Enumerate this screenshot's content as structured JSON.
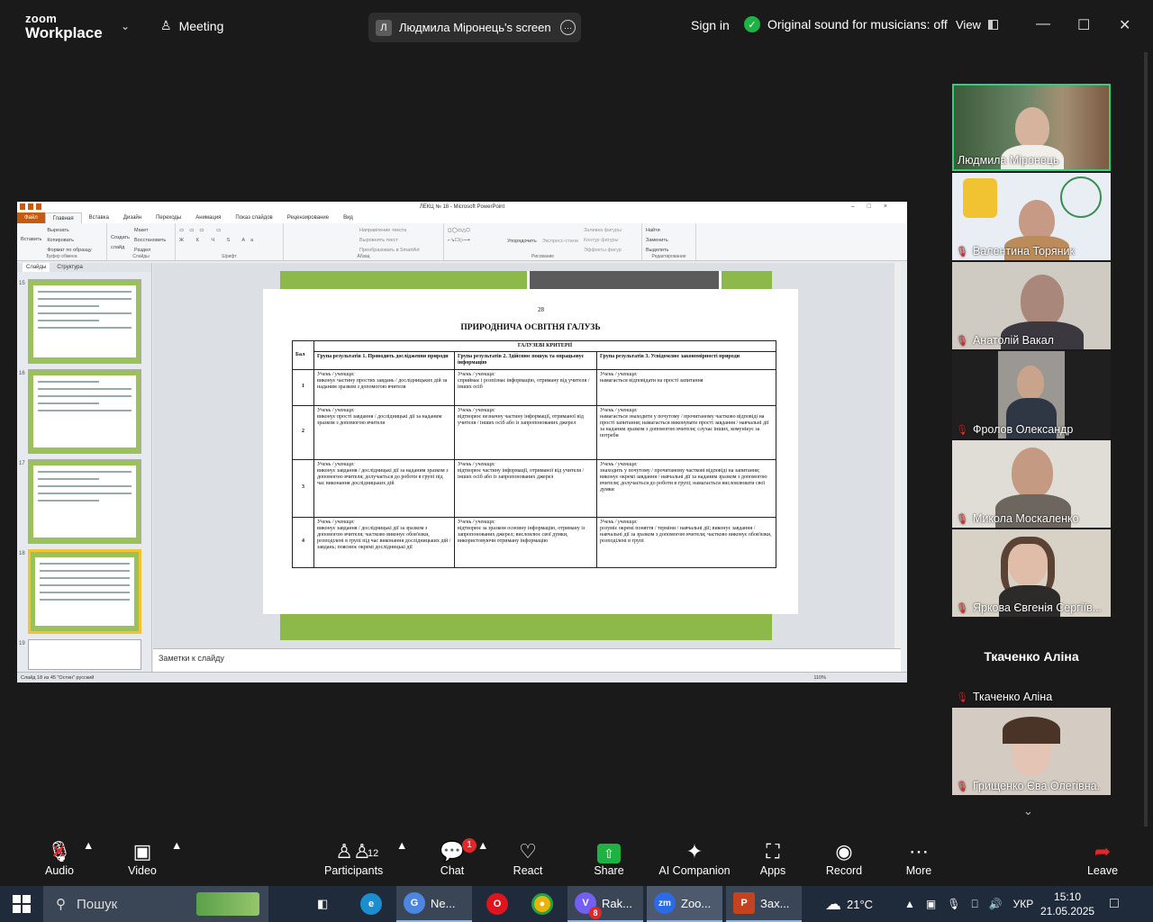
{
  "top_bar": {
    "logo_line1": "zoom",
    "logo_line2": "Workplace",
    "meeting_label": "Meeting",
    "share_initial": "Л",
    "share_title": "Людмила Міронець's screen",
    "sign_in": "Sign in",
    "original_sound": "Original sound for musicians: off",
    "view": "View"
  },
  "ppt": {
    "window_title": "ЛЕКЦ № 18 - Microsoft PowerPoint",
    "tabs": [
      "Файл",
      "Главная",
      "Вставка",
      "Дизайн",
      "Переходы",
      "Анимация",
      "Показ слайдов",
      "Рецензирование",
      "Вид"
    ],
    "ribbon": {
      "clipboard": [
        "Вставить",
        "Вырезать",
        "Копировать",
        "Формат по образцу"
      ],
      "clipboard_label": "Буфер обмена",
      "slides": [
        "Создать слайд",
        "Макет",
        "Восстановить",
        "Раздел"
      ],
      "slides_label": "Слайды",
      "font_label": "Шрифт",
      "paragraph": [
        "Направление текста",
        "Выровнять текст",
        "Преобразовать в SmartArt"
      ],
      "paragraph_label": "Абзац",
      "drawing": [
        "Упорядочить",
        "Экспресс-стили",
        "Заливка фигуры",
        "Контур фигуры",
        "Эффекты фигур"
      ],
      "drawing_label": "Рисование",
      "editing": [
        "Найти",
        "Заменить",
        "Выделить"
      ],
      "editing_label": "Редактирование"
    },
    "thumb_tabs": [
      "Слайды",
      "Структура"
    ],
    "thumb_numbers": [
      "15",
      "16",
      "17",
      "18",
      "19"
    ],
    "notes_placeholder": "Заметки к слайду",
    "status_bar": "Слайд 18 из 45   \"Остин\"   русский",
    "zoom_level": "110%"
  },
  "document": {
    "page_number": "28",
    "title": "ПРИРОДНИЧА ОСВІТНЯ ГАЛУЗЬ",
    "col_score": "Бал",
    "col_criteria": "ГАЛУЗЕВІ КРИТЕРІЇ",
    "group_headers": [
      "Група результатів 1. Проводить дослідження природи",
      "Група результатів 2. Здійснює пошук та опрацьовує інформацію",
      "Група результатів 3. Усвідомлює закономірності природи"
    ],
    "rows": [
      {
        "score": "1",
        "lead": "Учень / учениця:",
        "g1": "виконує частину простих завдань / дослідницьких дій за наданим зразком з допомогою вчителя",
        "g2": "сприймає і розпізнає інформацію, отриману від учителя / інших осіб",
        "g3": "намагається відповідати на прості запитання"
      },
      {
        "score": "2",
        "lead": "Учень / учениця:",
        "g1": "виконує прості завдання / дослідницькі дії за наданим зразком з допомогою вчителя",
        "g2": "відтворює незначну частину інформації, отриманої від учителя / інших осіб або із запропонованих джерел",
        "g3": "намагається знаходити у почутому / прочитаному частково відповіді на прості запитання; намагається виконувати прості завдання / навчальні дії за наданим зразком з допомогою вчителя; слухає інших, комунікує за потреби"
      },
      {
        "score": "3",
        "lead": "Учень / учениця:",
        "g1": "виконує завдання / дослідницькі дії за наданим зразком з допомогою вчителя; долучається до роботи в групі під час виконання дослідницьких дій",
        "g2": "відтворює частину інформації, отриманої від учителя / інших осіб або із запропонованих джерел",
        "g3": "знаходить у почутому / прочитаному часткові відповіді на запитання; виконує окремі завдання / навчальні дії за наданим зразком з допомогою вчителя; долучається до роботи в групі; намагається висловлювати свої думки"
      },
      {
        "score": "4",
        "lead": "Учень / учениця:",
        "g1": "виконує завдання / дослідницькі дії за зразком з допомогою вчителя; частково виконує обов'язки, розподілені в групі під час виконання дослідницьких дій / завдань; пояснює окремі дослідницькі дії",
        "g2": "відтворює за зразком основну інформацію, отриману із запропонованих джерел; висловлює свої думки, використовуючи отриману інформацію",
        "g3": "розуміє окремі поняття / терміни / навчальні дії; виконує завдання / навчальні дії за зразком з допомогою вчителя; частково виконує обов'язки, розподілені в групі"
      }
    ]
  },
  "participants": [
    {
      "name": "Людмила Міронець",
      "muted": false,
      "active": true
    },
    {
      "name": "Валентина Торяник",
      "muted": true,
      "active": false
    },
    {
      "name": "Анатолій Вакал",
      "muted": true,
      "active": false
    },
    {
      "name": "Фролов Олександр",
      "muted": true,
      "active": false
    },
    {
      "name": "Микола Москаленко",
      "muted": true,
      "active": false
    },
    {
      "name": "Яркова Євгенія Сергіїв...",
      "muted": true,
      "active": false
    },
    {
      "name": "Ткаченко Аліна",
      "muted": true,
      "active": false,
      "center_name": "Ткаченко Аліна"
    },
    {
      "name": "Грищенко Єва Олегівна.",
      "muted": true,
      "active": false
    }
  ],
  "toolbar": {
    "audio": "Audio",
    "video": "Video",
    "participants": "Participants",
    "participants_count": "12",
    "chat": "Chat",
    "chat_badge": "1",
    "react": "React",
    "share": "Share",
    "ai_companion": "AI Companion",
    "apps": "Apps",
    "record": "Record",
    "more": "More",
    "leave": "Leave"
  },
  "taskbar": {
    "search_placeholder": "Пошук",
    "apps": [
      {
        "label": "Ne...",
        "icon": "chrome-profile-icon"
      },
      {
        "label": "Rak...",
        "icon": "viber-icon",
        "badge": "8"
      },
      {
        "label": "Zoo...",
        "icon": "zoom-icon"
      },
      {
        "label": "Зах...",
        "icon": "powerpoint-icon"
      }
    ],
    "weather": "21°C",
    "language": "УКР",
    "time": "15:10",
    "date": "21.05.2025"
  },
  "colors": {
    "zoom_bg": "#1a1a1a",
    "active_speaker": "#2dd276",
    "mute_red": "#e02828",
    "share_green": "#1fb141",
    "slide_green": "#8db84a",
    "ppt_file_tab": "#c55a11"
  }
}
